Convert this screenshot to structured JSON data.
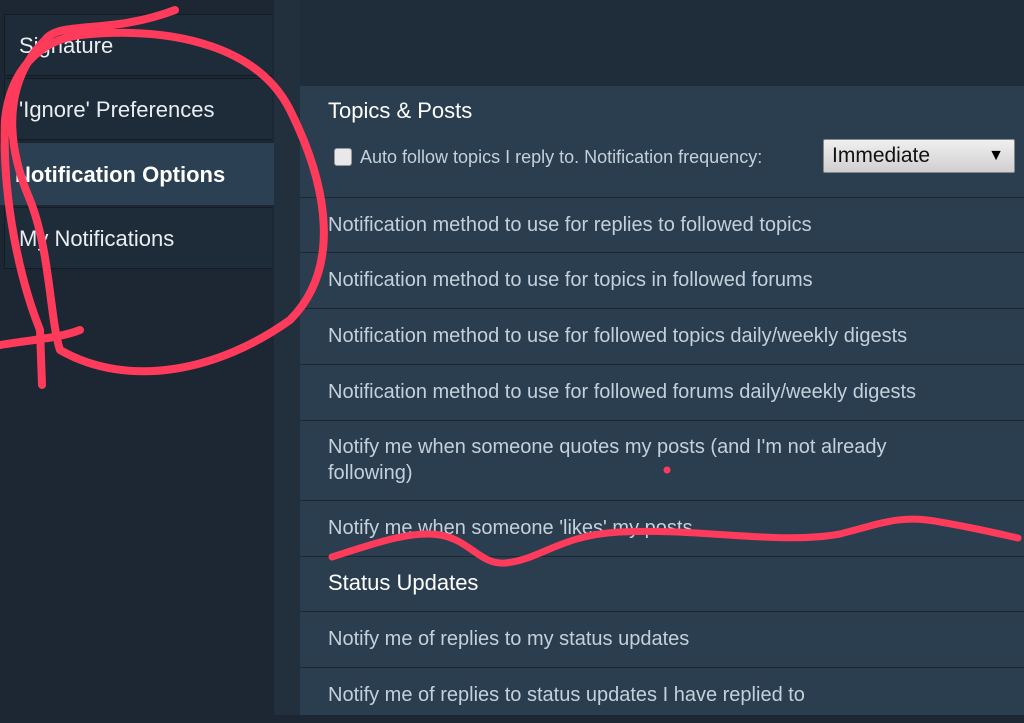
{
  "sidebar": {
    "items": [
      {
        "label": "Signature",
        "active": false
      },
      {
        "label": "'Ignore' Preferences",
        "active": false
      },
      {
        "label": "Notification Options",
        "active": true
      },
      {
        "label": "My Notifications",
        "active": false
      }
    ]
  },
  "main": {
    "topics_section_title": "Topics & Posts",
    "auto_follow_label": "Auto follow topics I reply to. Notification frequency:",
    "auto_follow_checked": false,
    "frequency_value": "Immediate",
    "rows": [
      "Notification method to use for replies to followed topics",
      "Notification method to use for topics in followed forums",
      "Notification method to use for followed topics daily/weekly digests",
      "Notification method to use for followed forums daily/weekly digests",
      "Notify me when someone quotes my posts (and I'm not already following)",
      "Notify me when someone 'likes' my posts"
    ],
    "status_section_title": "Status Updates",
    "status_rows": [
      "Notify me of replies to my status updates",
      "Notify me of replies to status updates I have replied to"
    ]
  },
  "colors": {
    "annotation": "#ff3b5c",
    "active_item_bg": "#2b4052",
    "panel_bg": "#2b3e50"
  },
  "icons": [
    "checkbox-icon",
    "dropdown-caret-icon"
  ]
}
